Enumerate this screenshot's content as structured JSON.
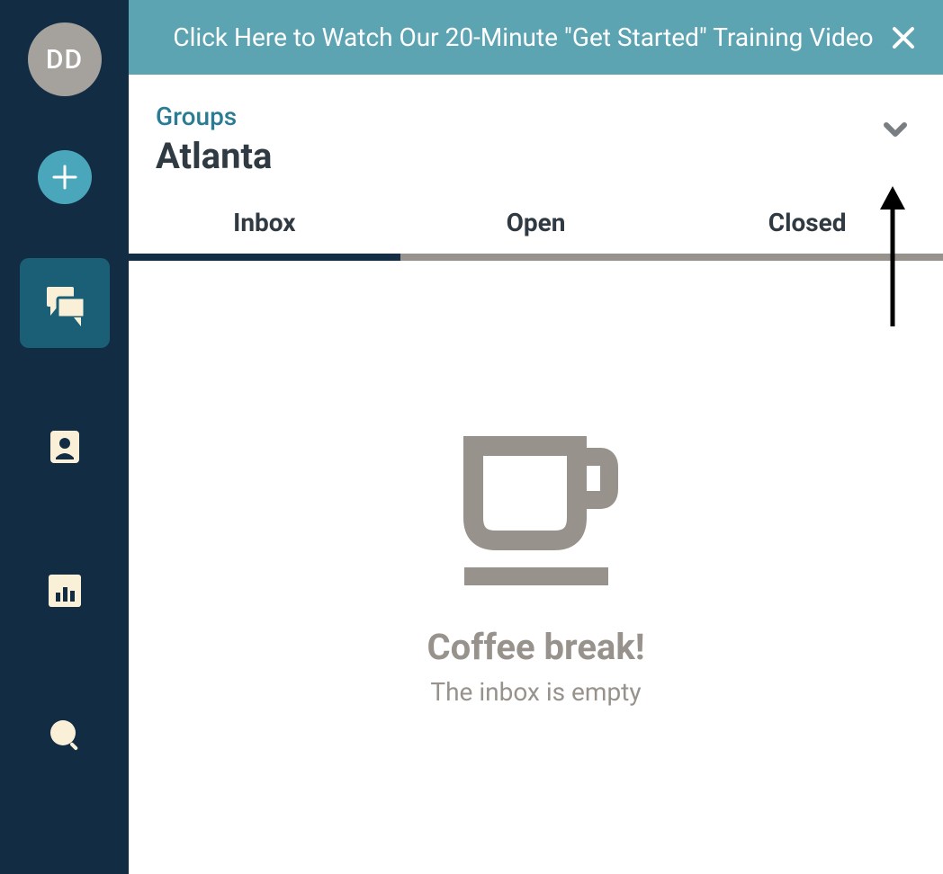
{
  "avatar_initials": "DD",
  "banner": {
    "text": "Click Here to Watch Our 20-Minute \"Get Started\" Training Video"
  },
  "header": {
    "crumb": "Groups",
    "title": "Atlanta"
  },
  "tabs": [
    {
      "label": "Inbox",
      "active": true
    },
    {
      "label": "Open",
      "active": false
    },
    {
      "label": "Closed",
      "active": false
    }
  ],
  "empty_state": {
    "title": "Coffee break!",
    "subtitle": "The inbox is empty"
  },
  "colors": {
    "sidebar_bg": "#122d43",
    "accent_teal": "#4aa7bb",
    "nav_active_bg": "#1b5f77",
    "banner_bg": "#5da4b3",
    "text_dark": "#303a42",
    "link_teal": "#2a7c94",
    "muted_gray": "#97928c",
    "cream": "#faf0d8"
  },
  "icons": {
    "add": "plus-icon",
    "messages": "chat-icon",
    "contacts": "contact-card-icon",
    "analytics": "bar-chart-icon",
    "search": "search-icon",
    "close": "close-icon",
    "caret": "chevron-down-icon",
    "empty": "coffee-cup-icon"
  }
}
